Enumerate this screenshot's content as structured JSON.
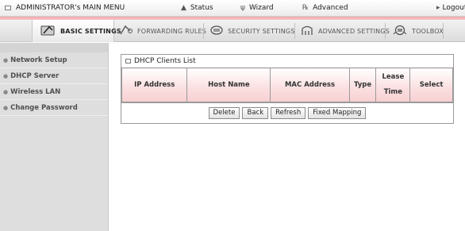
{
  "topbar": {
    "admin_title": "ADMINISTRATOR's MAIN MENU",
    "status": "Status",
    "wizard": "Wizard",
    "advanced": "Advanced",
    "logout": "Logout"
  },
  "tabs": [
    {
      "label": "BASIC SETTINGS",
      "icon": "basic-settings-icon",
      "active": true
    },
    {
      "label": "FORWARDING RULES",
      "icon": "forwarding-rules-icon",
      "active": false
    },
    {
      "label": "SECURITY SETTINGS",
      "icon": "security-settings-icon",
      "active": false
    },
    {
      "label": "ADVANCED SETTINGS",
      "icon": "advanced-settings-icon",
      "active": false
    },
    {
      "label": "TOOLBOX",
      "icon": "toolbox-icon",
      "active": false
    }
  ],
  "sidebar": {
    "items": [
      {
        "label": "Network Setup"
      },
      {
        "label": "DHCP Server"
      },
      {
        "label": "Wireless LAN"
      },
      {
        "label": "Change Password"
      }
    ]
  },
  "panel": {
    "title": "DHCP Clients List",
    "columns": {
      "ip": "IP Address",
      "host": "Host Name",
      "mac": "MAC Address",
      "type": "Type",
      "lease_line1": "Lease",
      "lease_line2": "Time",
      "select": "Select"
    },
    "buttons": {
      "delete": "Delete",
      "back": "Back",
      "refresh": "Refresh",
      "fixed_mapping": "Fixed Mapping"
    }
  },
  "colors": {
    "accent_pink": "#f4a8ad",
    "header_pink": "#f7cfd1",
    "sidebar_bg": "#dedede"
  }
}
